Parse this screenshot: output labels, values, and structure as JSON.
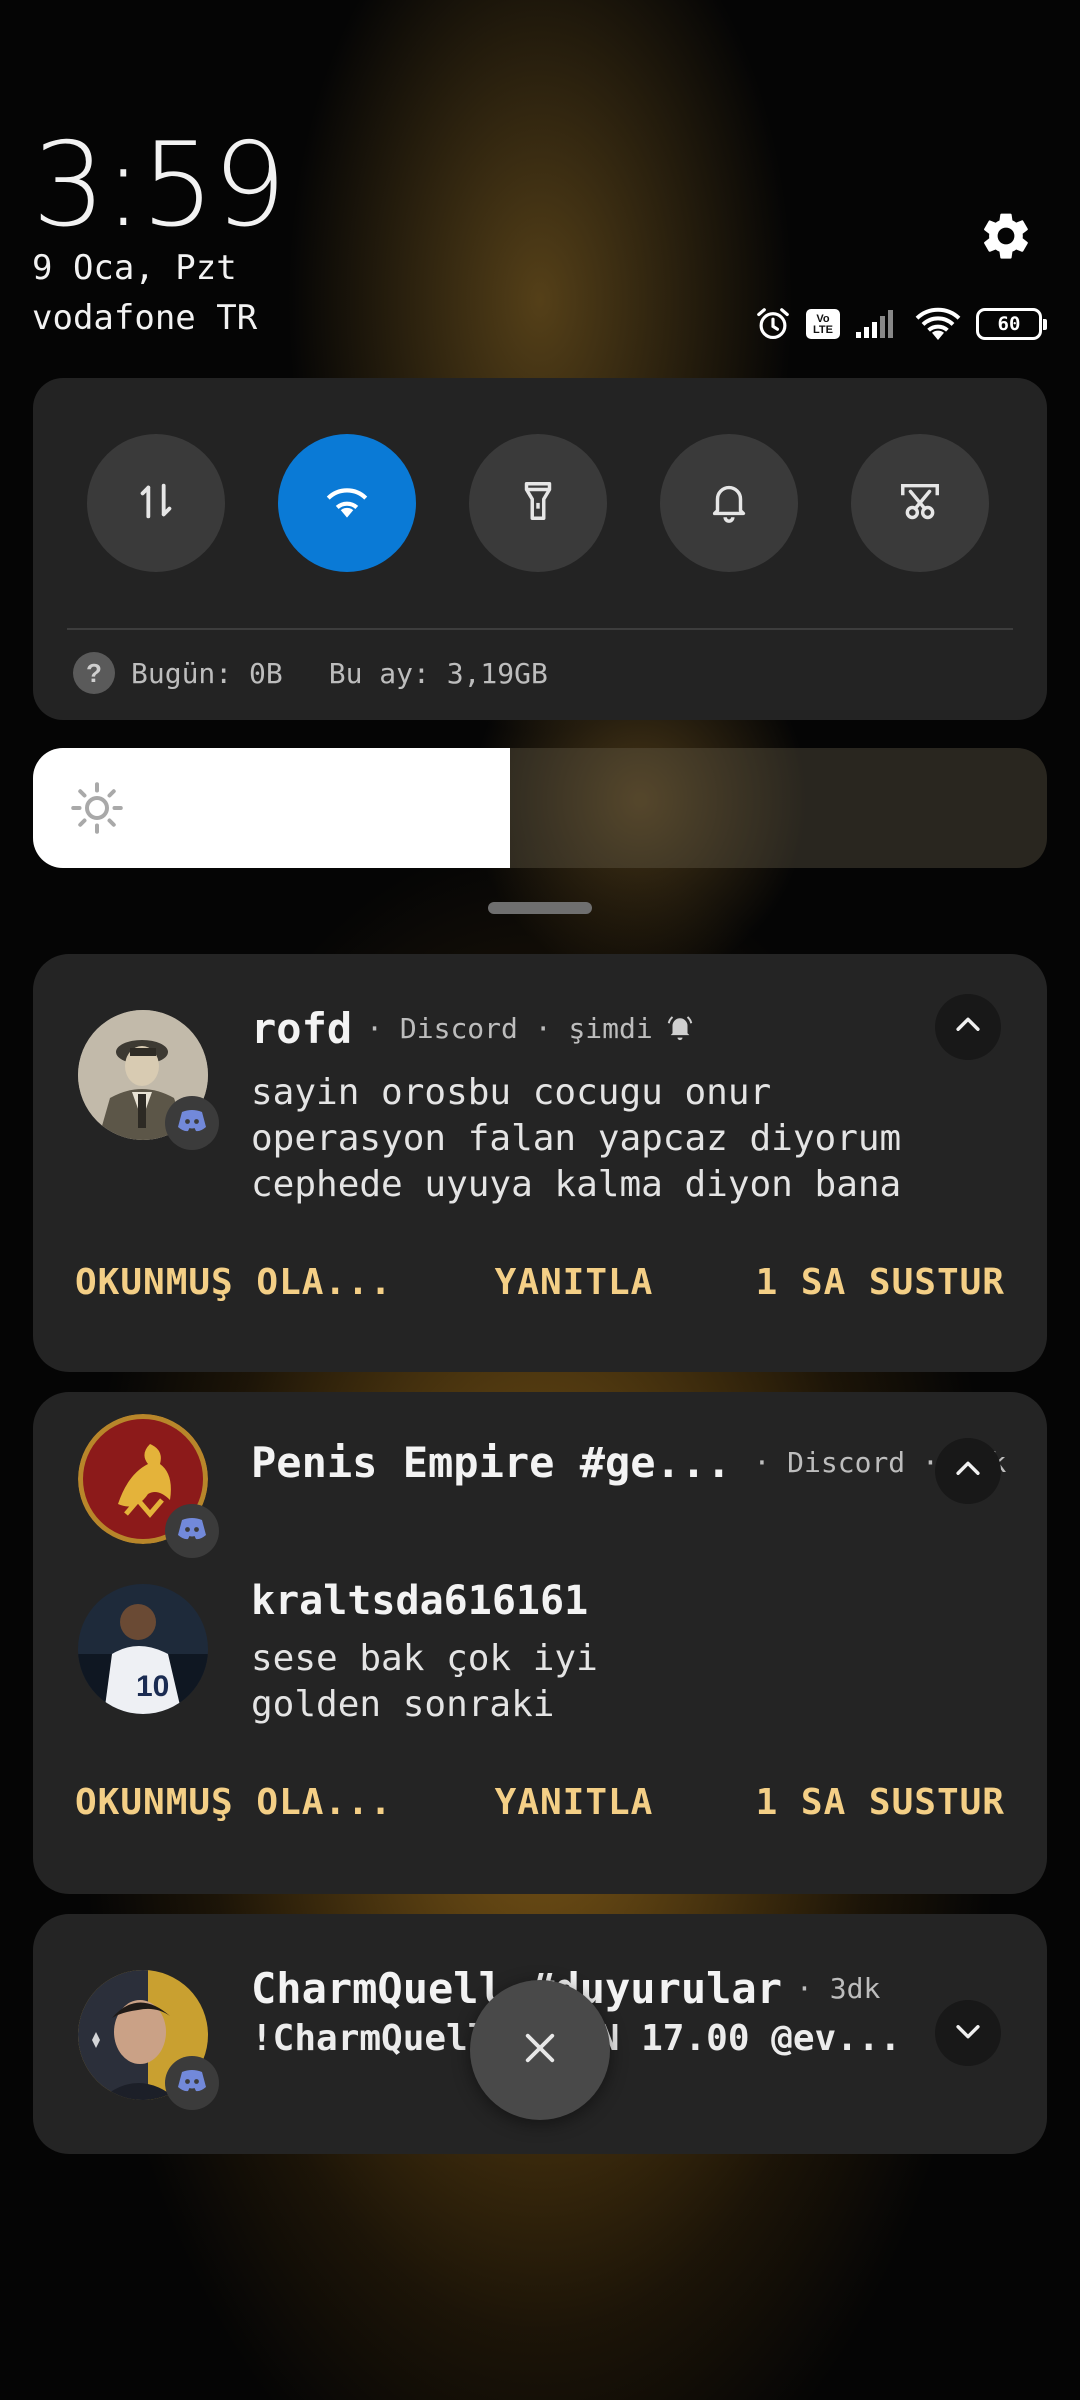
{
  "header": {
    "time": "3:59",
    "date": "9 Oca, Pzt",
    "carrier": "vodafone TR",
    "settings_icon": "gear-icon",
    "status_icons": [
      "alarm-icon",
      "volte-icon",
      "signal-icon",
      "wifi-icon",
      "battery-icon"
    ],
    "volte_label": "Vo\nLTE",
    "battery_level": "60"
  },
  "quick_settings": {
    "toggles": [
      {
        "name": "mobile-data",
        "icon": "data-arrows-icon",
        "active": false
      },
      {
        "name": "wifi",
        "icon": "wifi-icon",
        "active": true
      },
      {
        "name": "flashlight",
        "icon": "flashlight-icon",
        "active": false
      },
      {
        "name": "sound",
        "icon": "bell-icon",
        "active": false
      },
      {
        "name": "screenshot",
        "icon": "scissors-icon",
        "active": false
      }
    ],
    "data_usage": {
      "help_symbol": "?",
      "today": "Bugün: 0B",
      "month": "Bu ay: 3,19GB"
    },
    "accent_color": "#0a7ad6"
  },
  "brightness": {
    "level_percent": 47,
    "icon": "sun-icon"
  },
  "notifications": [
    {
      "title": "rofd",
      "meta": "· Discord · şimdi",
      "alert_icon": "bell-ring-icon",
      "body": "sayin orosbu cocugu onur\noperasyon falan yapcaz diyorum\ncephede uyuya kalma diyon bana",
      "expand_icon": "chevron-up-icon",
      "actions": [
        "OKUNMUŞ OLA...",
        "YANITLA",
        "1 SA SUSTUR"
      ]
    },
    {
      "title": "Penis Empire #ge...",
      "meta": "· Discord · 3dk",
      "expand_icon": "chevron-up-icon",
      "sender": "kraltsda616161",
      "body": "sese bak çok iyi\ngolden sonraki",
      "actions": [
        "OKUNMUŞ OLA...",
        "YANITLA",
        "1 SA SUSTUR"
      ]
    },
    {
      "title": "CharmQuell #duyurular",
      "meta": "· 3dk",
      "body": "!CharmQuell YARIN 17.00 @ev...",
      "expand_icon": "chevron-down-icon"
    }
  ],
  "dismiss_icon": "close-icon",
  "colors": {
    "action_text": "#f4cf86",
    "card_bg": "#242424",
    "discord_badge": "#7289da"
  }
}
